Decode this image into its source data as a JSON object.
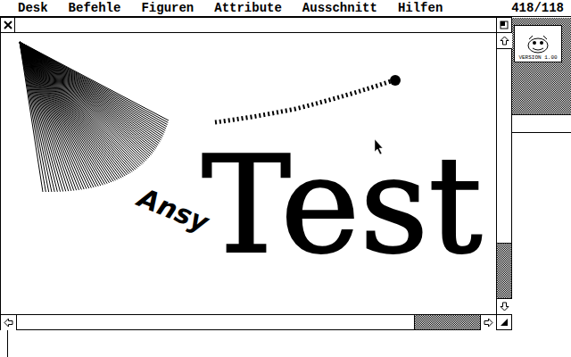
{
  "menu_bar": {
    "items": [
      "Desk",
      "Befehle",
      "Figuren",
      "Attribute",
      "Ausschnitt",
      "Hilfen"
    ],
    "coordinates": "418/118"
  },
  "logo": {
    "version": "VERSION 1.00"
  },
  "window": {
    "vertical_scrollbar": {
      "level": 0.78
    },
    "horizontal_scrollbar": {
      "level": 0.86
    }
  },
  "canvas": {
    "texts": [
      {
        "text": "Test",
        "kind": "spray"
      },
      {
        "text": "Ansy",
        "kind": "brush"
      }
    ]
  }
}
